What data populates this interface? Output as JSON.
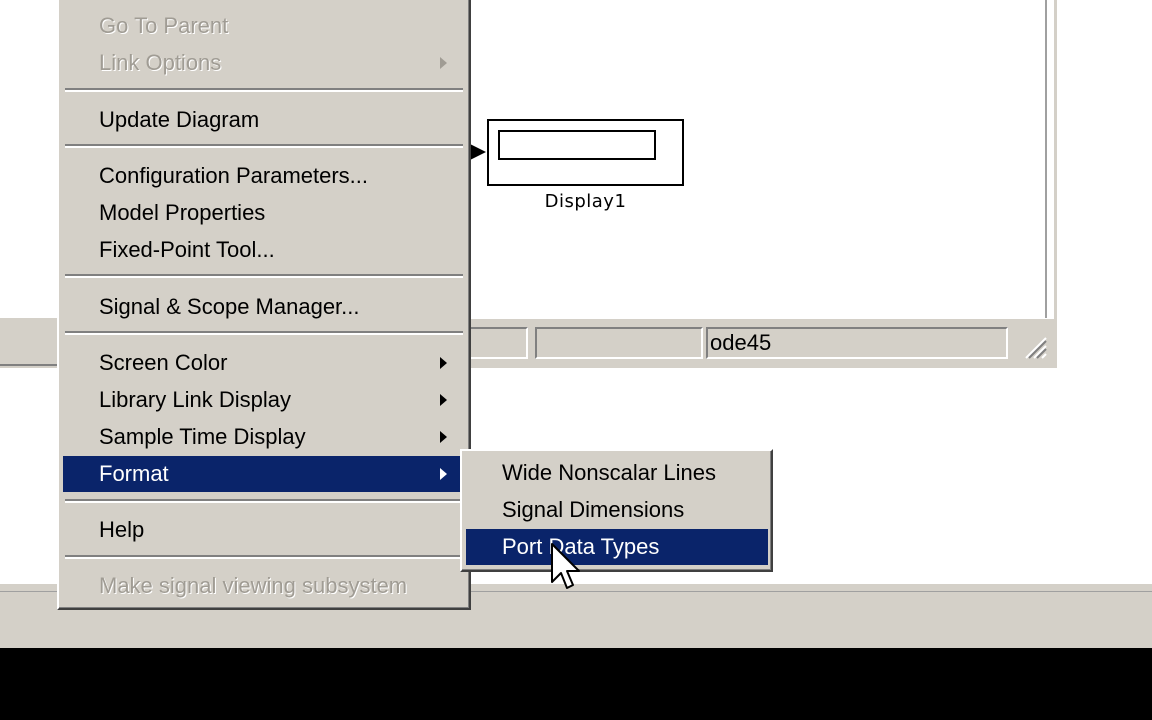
{
  "canvas": {
    "display_block_label": "Display1"
  },
  "status_bar": {
    "solver": "ode45"
  },
  "context_menu": {
    "items": [
      {
        "label": "Go To Parent",
        "disabled": true
      },
      {
        "label": "Link Options",
        "disabled": true,
        "submenu": true
      },
      {
        "label": "Update Diagram"
      },
      {
        "label": "Configuration Parameters..."
      },
      {
        "label": "Model Properties"
      },
      {
        "label": "Fixed-Point Tool..."
      },
      {
        "label": "Signal & Scope Manager..."
      },
      {
        "label": "Screen Color",
        "submenu": true
      },
      {
        "label": "Library Link Display",
        "submenu": true
      },
      {
        "label": "Sample Time Display",
        "submenu": true
      },
      {
        "label": "Format",
        "submenu": true,
        "selected": true
      },
      {
        "label": "Help"
      },
      {
        "label": "Make signal viewing subsystem",
        "disabled": true
      }
    ]
  },
  "format_submenu": {
    "items": [
      {
        "label": "Wide Nonscalar Lines"
      },
      {
        "label": "Signal Dimensions"
      },
      {
        "label": "Port Data Types",
        "selected": true
      }
    ]
  },
  "colors": {
    "menu_bg": "#d4d0c8",
    "highlight": "#0a246a",
    "disabled_text": "#a09c94"
  }
}
